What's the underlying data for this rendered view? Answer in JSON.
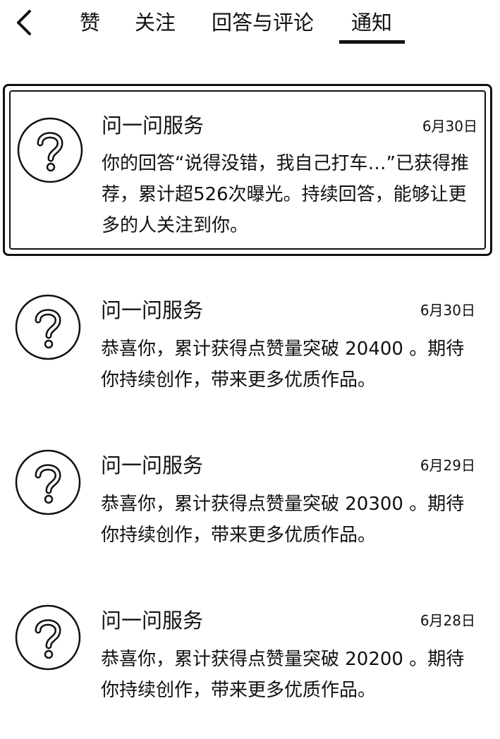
{
  "header": {
    "back_icon": "chevron-left-icon",
    "tabs": [
      {
        "label": "赞"
      },
      {
        "label": "关注"
      },
      {
        "label": "回答与评论"
      },
      {
        "label": "通知",
        "active": true
      }
    ]
  },
  "notifications": [
    {
      "avatar_icon": "question-mark-icon",
      "sender": "问一问服务",
      "date": "6月30日",
      "message": "你的回答“说得没错，我自己打车…”已获得推荐，累计超526次曝光。持续回答，能够让更多的人关注到你。",
      "highlighted": true
    },
    {
      "avatar_icon": "question-mark-icon",
      "sender": "问一问服务",
      "date": "6月30日",
      "message": "恭喜你，累计获得点赞量突破 20400 。期待你持续创作，带来更多优质作品。"
    },
    {
      "avatar_icon": "question-mark-icon",
      "sender": "问一问服务",
      "date": "6月29日",
      "message": "恭喜你，累计获得点赞量突破 20300 。期待你持续创作，带来更多优质作品。"
    },
    {
      "avatar_icon": "question-mark-icon",
      "sender": "问一问服务",
      "date": "6月28日",
      "message": "恭喜你，累计获得点赞量突破 20200 。期待你持续创作，带来更多优质作品。"
    }
  ]
}
